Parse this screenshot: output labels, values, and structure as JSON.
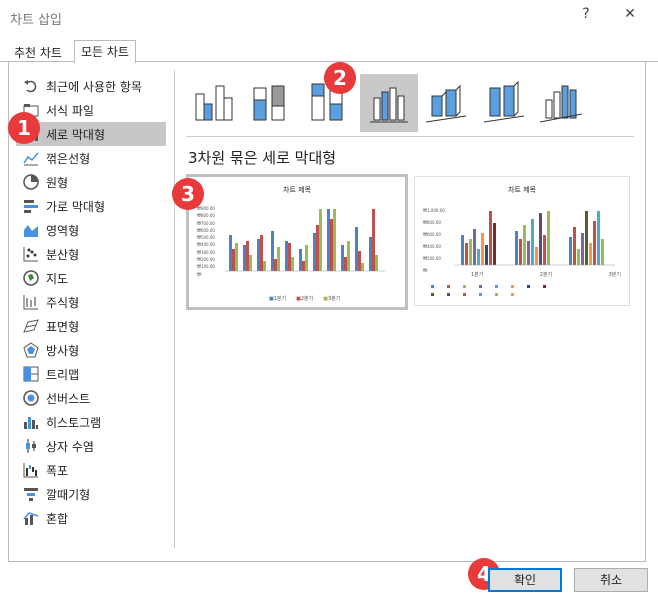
{
  "window": {
    "title": "차트 삽입",
    "help": "?",
    "close": "✕"
  },
  "tabs": [
    {
      "label": "추천 차트"
    },
    {
      "label": "모든 차트"
    }
  ],
  "sidebar": {
    "items": [
      {
        "label": "최근에 사용한 항목",
        "icon": "undo-icon"
      },
      {
        "label": "서식 파일",
        "icon": "folder-icon"
      },
      {
        "label": "세로 막대형",
        "icon": "column-chart-icon",
        "selected": true
      },
      {
        "label": "꺾은선형",
        "icon": "line-chart-icon"
      },
      {
        "label": "원형",
        "icon": "pie-chart-icon"
      },
      {
        "label": "가로 막대형",
        "icon": "bar-chart-icon"
      },
      {
        "label": "영역형",
        "icon": "area-chart-icon"
      },
      {
        "label": "분산형",
        "icon": "scatter-chart-icon"
      },
      {
        "label": "지도",
        "icon": "map-chart-icon"
      },
      {
        "label": "주식형",
        "icon": "stock-chart-icon"
      },
      {
        "label": "표면형",
        "icon": "surface-chart-icon"
      },
      {
        "label": "방사형",
        "icon": "radar-chart-icon"
      },
      {
        "label": "트리맵",
        "icon": "treemap-chart-icon"
      },
      {
        "label": "선버스트",
        "icon": "sunburst-chart-icon"
      },
      {
        "label": "히스토그램",
        "icon": "histogram-chart-icon"
      },
      {
        "label": "상자 수염",
        "icon": "boxwhisker-chart-icon"
      },
      {
        "label": "폭포",
        "icon": "waterfall-chart-icon"
      },
      {
        "label": "깔때기형",
        "icon": "funnel-chart-icon"
      },
      {
        "label": "혼합",
        "icon": "combo-chart-icon"
      }
    ]
  },
  "subtypes": {
    "selected_index": 3,
    "heading": "3차원 묶은 세로 막대형"
  },
  "preview1": {
    "title": "차트 제목",
    "yticks": [
      "₩900.00",
      "₩800.00",
      "₩700.00",
      "₩600.00",
      "₩500.00",
      "₩400.00",
      "₩300.00",
      "₩200.00",
      "₩100.00",
      "₩-"
    ],
    "legend": [
      "1분기",
      "2분기",
      "3분기"
    ]
  },
  "preview2": {
    "title": "차트 제목",
    "yticks": [
      "₩1,000.00",
      "₩800.00",
      "₩600.00",
      "₩400.00",
      "₩200.00",
      "₩-"
    ],
    "categories": [
      "1분기",
      "2분기",
      "3분기"
    ]
  },
  "badges": [
    "1",
    "2",
    "3",
    "4"
  ],
  "buttons": {
    "ok": "확인",
    "cancel": "취소"
  },
  "colors": {
    "accent": "#0078d7",
    "badge": "#e8393b",
    "selected": "#c6c6c6"
  }
}
